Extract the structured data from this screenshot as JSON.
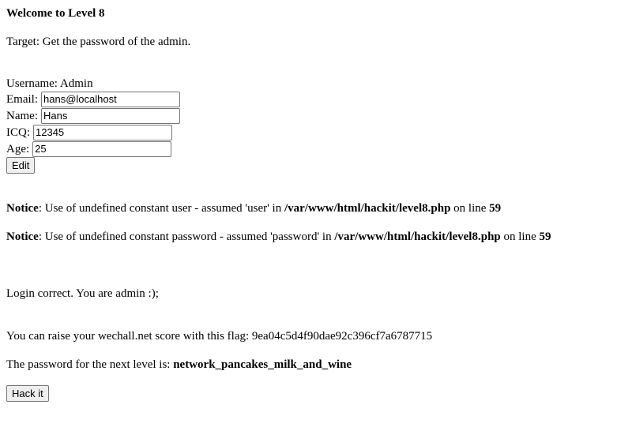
{
  "heading": "Welcome to Level 8",
  "target": "Target: Get the password of the admin.",
  "profile": {
    "username_label": "Username:",
    "username_value": "Admin",
    "email_label": "Email:",
    "email_value": "hans@localhost",
    "name_label": "Name:",
    "name_value": "Hans",
    "icq_label": "ICQ:",
    "icq_value": "12345",
    "age_label": "Age:",
    "age_value": "25",
    "edit_label": "Edit"
  },
  "notices": [
    {
      "label": "Notice",
      "message": ": Use of undefined constant user - assumed 'user' in ",
      "path": "/var/www/html/hackit/level8.php",
      "line_text": " on line ",
      "line": "59"
    },
    {
      "label": "Notice",
      "message": ": Use of undefined constant password - assumed 'password' in ",
      "path": "/var/www/html/hackit/level8.php",
      "line_text": " on line ",
      "line": "59"
    }
  ],
  "login_message": "Login correct. You are admin :);",
  "flag_text": "You can raise your wechall.net score with this flag: 9ea04c5d4f90dae92c396cf7a6787715",
  "password_prefix": "The password for the next level is: ",
  "password_value": "network_pancakes_milk_and_wine",
  "hack_label": "Hack it"
}
